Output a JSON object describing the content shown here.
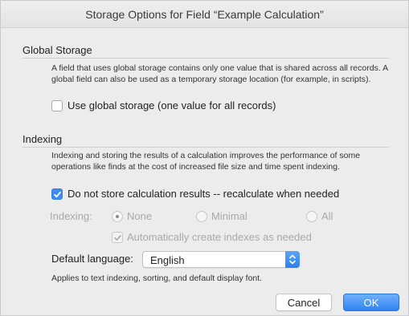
{
  "dialog": {
    "title": "Storage Options for Field “Example Calculation”"
  },
  "global_storage": {
    "heading": "Global Storage",
    "description": "A field that uses global storage contains only one value that is shared across all records.  A global field can also be used as a temporary storage location (for example, in scripts).",
    "checkbox_label": "Use global storage (one value for all records)",
    "checked": false
  },
  "indexing": {
    "heading": "Indexing",
    "description": "Indexing and storing the results of a calculation improves the performance of some operations like finds at the cost of increased file size and time spent indexing.",
    "no_store_label": "Do not store calculation results -- recalculate when needed",
    "no_store_checked": true,
    "indexing_label": "Indexing:",
    "options": [
      "None",
      "Minimal",
      "All"
    ],
    "selected_option": "None",
    "auto_index_label": "Automatically create indexes as needed",
    "auto_index_checked": true,
    "default_language_label": "Default language:",
    "default_language_value": "English",
    "language_note": "Applies to text indexing, sorting, and default display font."
  },
  "buttons": {
    "cancel": "Cancel",
    "ok": "OK"
  },
  "colors": {
    "accent": "#3d8ef0",
    "dialog_bg": "#ececec",
    "disabled_text": "#a9a9a9"
  },
  "icons": {
    "check": "checkmark-icon",
    "popup": "updown-chevron-icon"
  }
}
